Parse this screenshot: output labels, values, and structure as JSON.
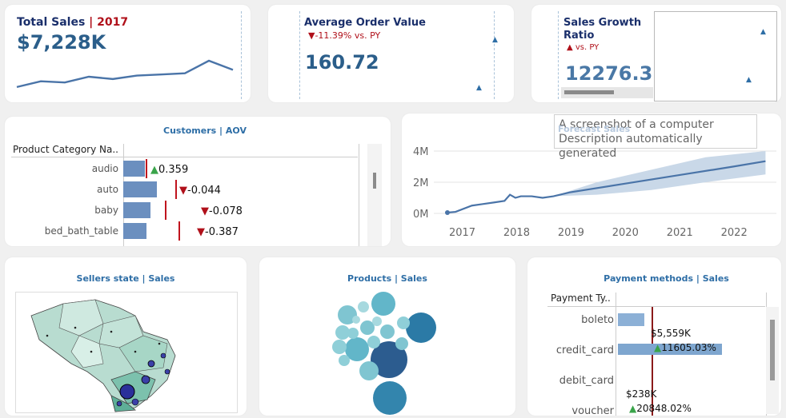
{
  "kpi_sales": {
    "title": "Total Sales",
    "separator": " | ",
    "year": "2017",
    "value": "$7,228K",
    "sparkline": [
      5,
      10,
      9,
      14,
      12,
      15,
      16,
      17,
      28,
      20
    ]
  },
  "kpi_aov": {
    "title": "Average Order Value",
    "delta": "▼-11.39% vs. PY",
    "value": "160.72"
  },
  "kpi_growth": {
    "title_line1": "Sales Growth",
    "title_line2": "Ratio",
    "delta": "▲ vs. PY",
    "value": "12276.3"
  },
  "customers_aov": {
    "title": "Customers | AOV",
    "header": "Product Category Na..",
    "rows": [
      {
        "label": "audio",
        "bar": 0.19,
        "delta": "0.359",
        "dir": "up",
        "arrow": "▲"
      },
      {
        "label": "auto",
        "bar": 0.3,
        "delta": "-0.044",
        "dir": "down",
        "arrow": "▼"
      },
      {
        "label": "baby",
        "bar": 0.24,
        "delta": "-0.078",
        "dir": "down",
        "arrow": "▼"
      },
      {
        "label": "bed_bath_table",
        "bar": 0.21,
        "delta": "-0.387",
        "dir": "down",
        "arrow": "▼"
      }
    ]
  },
  "tooltip": {
    "line1": "A screenshot of a computer",
    "line2": "Description automatically generated"
  },
  "forecast": {
    "title": "Forecast Sales",
    "chart_data": {
      "type": "line",
      "x": [
        2016.75,
        2016.9,
        2017.2,
        2017.4,
        2017.6,
        2017.8,
        2017.9,
        2018.0,
        2018.1,
        2018.3,
        2018.5,
        2018.7,
        2019,
        2020,
        2021,
        2022,
        2022.6
      ],
      "values": [
        0.05,
        0.1,
        0.5,
        0.6,
        0.7,
        0.8,
        1.2,
        1.0,
        1.1,
        1.1,
        1.0,
        1.1,
        1.35,
        1.9,
        2.45,
        3.0,
        3.35
      ],
      "forecast_band_upper": [
        1.1,
        2.0,
        2.8,
        3.6,
        4.0
      ],
      "forecast_band_lower": [
        1.1,
        1.2,
        1.5,
        2.0,
        2.5
      ],
      "band_x": [
        2018.7,
        2019.5,
        2020.5,
        2021.5,
        2022.6
      ],
      "y_ticks": [
        "4M",
        "2M",
        "0M"
      ],
      "x_ticks": [
        "2017",
        "2018",
        "2019",
        "2020",
        "2021",
        "2022"
      ],
      "ylim": [
        0,
        4
      ]
    }
  },
  "sellers": {
    "title": "Sellers state | Sales"
  },
  "products": {
    "title": "Products | Sales"
  },
  "payments": {
    "title": "Payment methods | Sales",
    "header": "Payment Ty..",
    "rows": [
      {
        "label": "boleto",
        "bar": 0.25,
        "value": "",
        "delta": ""
      },
      {
        "label": "credit_card",
        "bar": 1.0,
        "value": "$5,559K",
        "delta": "11605.03%"
      },
      {
        "label": "debit_card",
        "bar": 0.0,
        "value": "",
        "delta": ""
      },
      {
        "label": "voucher",
        "bar": 0.0,
        "value": "$238K",
        "delta": "20848.02%"
      }
    ]
  },
  "colors": {
    "accent": "#2e6ea6",
    "bar": "#6b8fbf",
    "title_dark": "#1a2f6b",
    "red": "#b0101a",
    "green": "#3aa44a"
  }
}
